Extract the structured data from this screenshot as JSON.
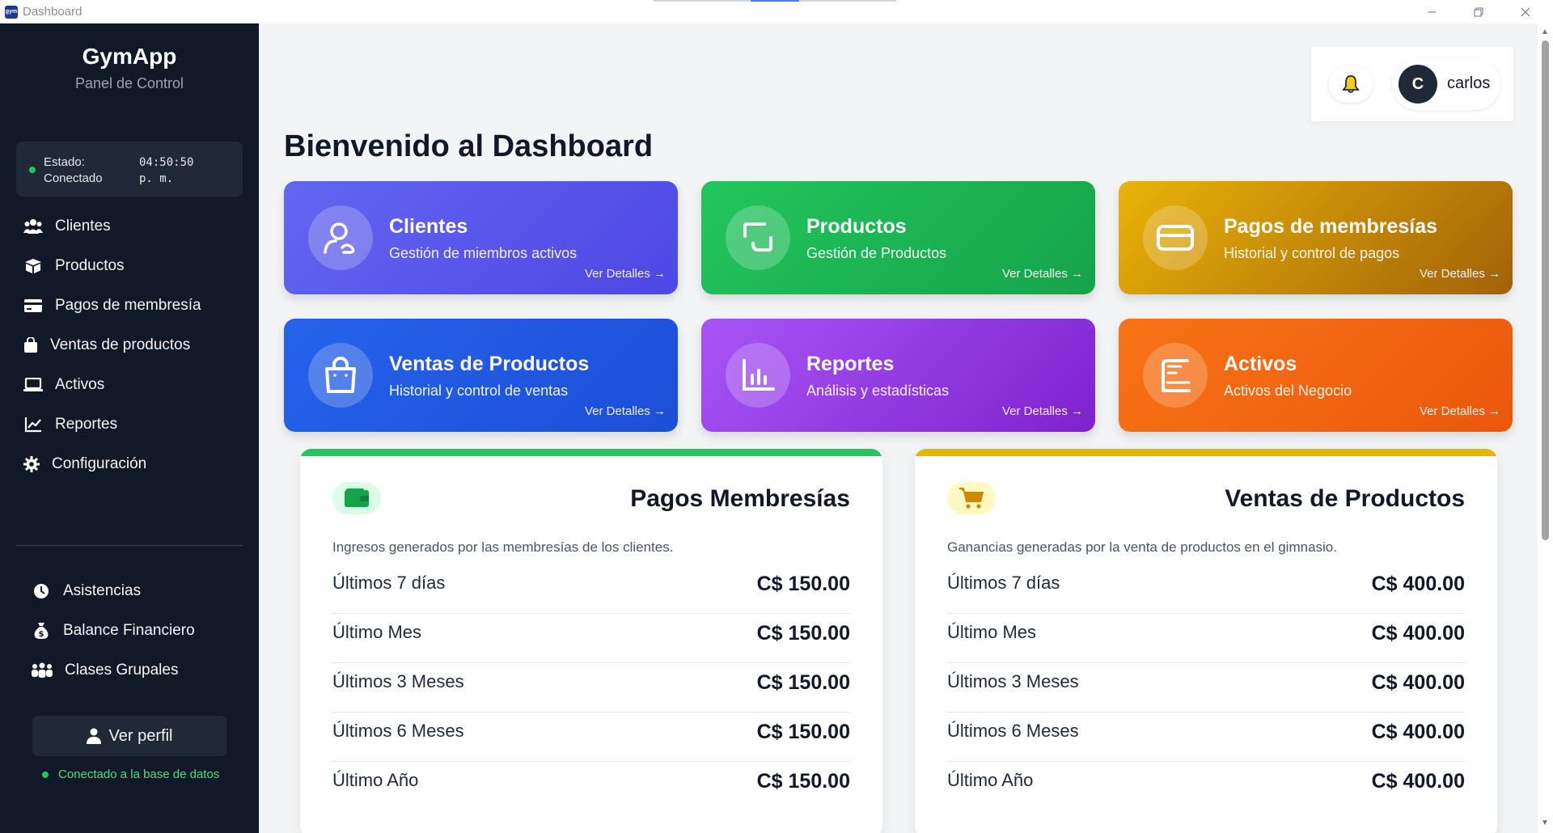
{
  "window": {
    "title": "Dashboard",
    "app_icon_text": "gym"
  },
  "sidebar": {
    "brand": "GymApp",
    "subtitle": "Panel de Control",
    "status": {
      "label_line1": "Estado:",
      "label_line2": "Conectado",
      "time_line1": "04:50:50",
      "time_line2": "p. m."
    },
    "items": [
      {
        "label": "Clientes",
        "icon": "users-icon"
      },
      {
        "label": "Productos",
        "icon": "box-icon"
      },
      {
        "label": "Pagos de membresía",
        "icon": "credit-card-icon"
      },
      {
        "label": "Ventas de productos",
        "icon": "shopping-bag-icon"
      },
      {
        "label": "Activos",
        "icon": "laptop-icon"
      },
      {
        "label": "Reportes",
        "icon": "chart-line-icon"
      },
      {
        "label": "Configuración",
        "icon": "gear-icon"
      }
    ],
    "secondary_items": [
      {
        "label": "Asistencias",
        "icon": "clock-icon"
      },
      {
        "label": "Balance Financiero",
        "icon": "money-bag-icon"
      },
      {
        "label": "Clases Grupales",
        "icon": "group-icon"
      }
    ],
    "profile_button": "Ver perfil",
    "db_status": "Conectado a la base de datos"
  },
  "header": {
    "user_initial": "C",
    "user_name": "carlos"
  },
  "main": {
    "title": "Bienvenido al Dashboard",
    "cards": [
      {
        "title": "Clientes",
        "subtitle": "Gestión de miembros activos",
        "link": "Ver Detalles →",
        "color_from": "#6366f1",
        "color_to": "#4f46e5",
        "icon": "users-icon"
      },
      {
        "title": "Productos",
        "subtitle": "Gestión de Productos",
        "link": "Ver Detalles →",
        "color_from": "#22c55e",
        "color_to": "#16a34a",
        "icon": "product-icon"
      },
      {
        "title": "Pagos de membresías",
        "subtitle": "Historial y control de pagos",
        "link": "Ver Detalles →",
        "color_from": "#eab308",
        "color_to": "#a16207",
        "icon": "credit-card-icon"
      },
      {
        "title": "Ventas de Productos",
        "subtitle": "Historial y control de ventas",
        "link": "Ver Detalles →",
        "color_from": "#2563eb",
        "color_to": "#1d4ed8",
        "icon": "shopping-bag-icon"
      },
      {
        "title": "Reportes",
        "subtitle": "Análisis y estadísticas",
        "link": "Ver Detalles →",
        "color_from": "#a855f7",
        "color_to": "#7e22ce",
        "icon": "bar-chart-icon"
      },
      {
        "title": "Activos",
        "subtitle": "Activos del Negocio",
        "link": "Ver Detalles →",
        "color_from": "#f97316",
        "color_to": "#ea580c",
        "icon": "assets-icon"
      }
    ],
    "panels": [
      {
        "title": "Pagos Membresías",
        "description": "Ingresos generados por las membresías de los clientes.",
        "accent": "#22c55e",
        "icon": "wallet-icon",
        "rows": [
          {
            "label": "Últimos 7 días",
            "value": "C$ 150.00"
          },
          {
            "label": "Último Mes",
            "value": "C$ 150.00"
          },
          {
            "label": "Últimos 3 Meses",
            "value": "C$ 150.00"
          },
          {
            "label": "Últimos 6 Meses",
            "value": "C$ 150.00"
          },
          {
            "label": "Último Año",
            "value": "C$ 150.00"
          }
        ]
      },
      {
        "title": "Ventas de Productos",
        "description": "Ganancias generadas por la venta de productos en el gimnasio.",
        "accent": "#eab308",
        "icon": "cart-icon",
        "rows": [
          {
            "label": "Últimos 7 días",
            "value": "C$ 400.00"
          },
          {
            "label": "Último Mes",
            "value": "C$ 400.00"
          },
          {
            "label": "Últimos 3 Meses",
            "value": "C$ 400.00"
          },
          {
            "label": "Últimos 6 Meses",
            "value": "C$ 400.00"
          },
          {
            "label": "Último Año",
            "value": "C$ 400.00"
          }
        ]
      }
    ]
  }
}
